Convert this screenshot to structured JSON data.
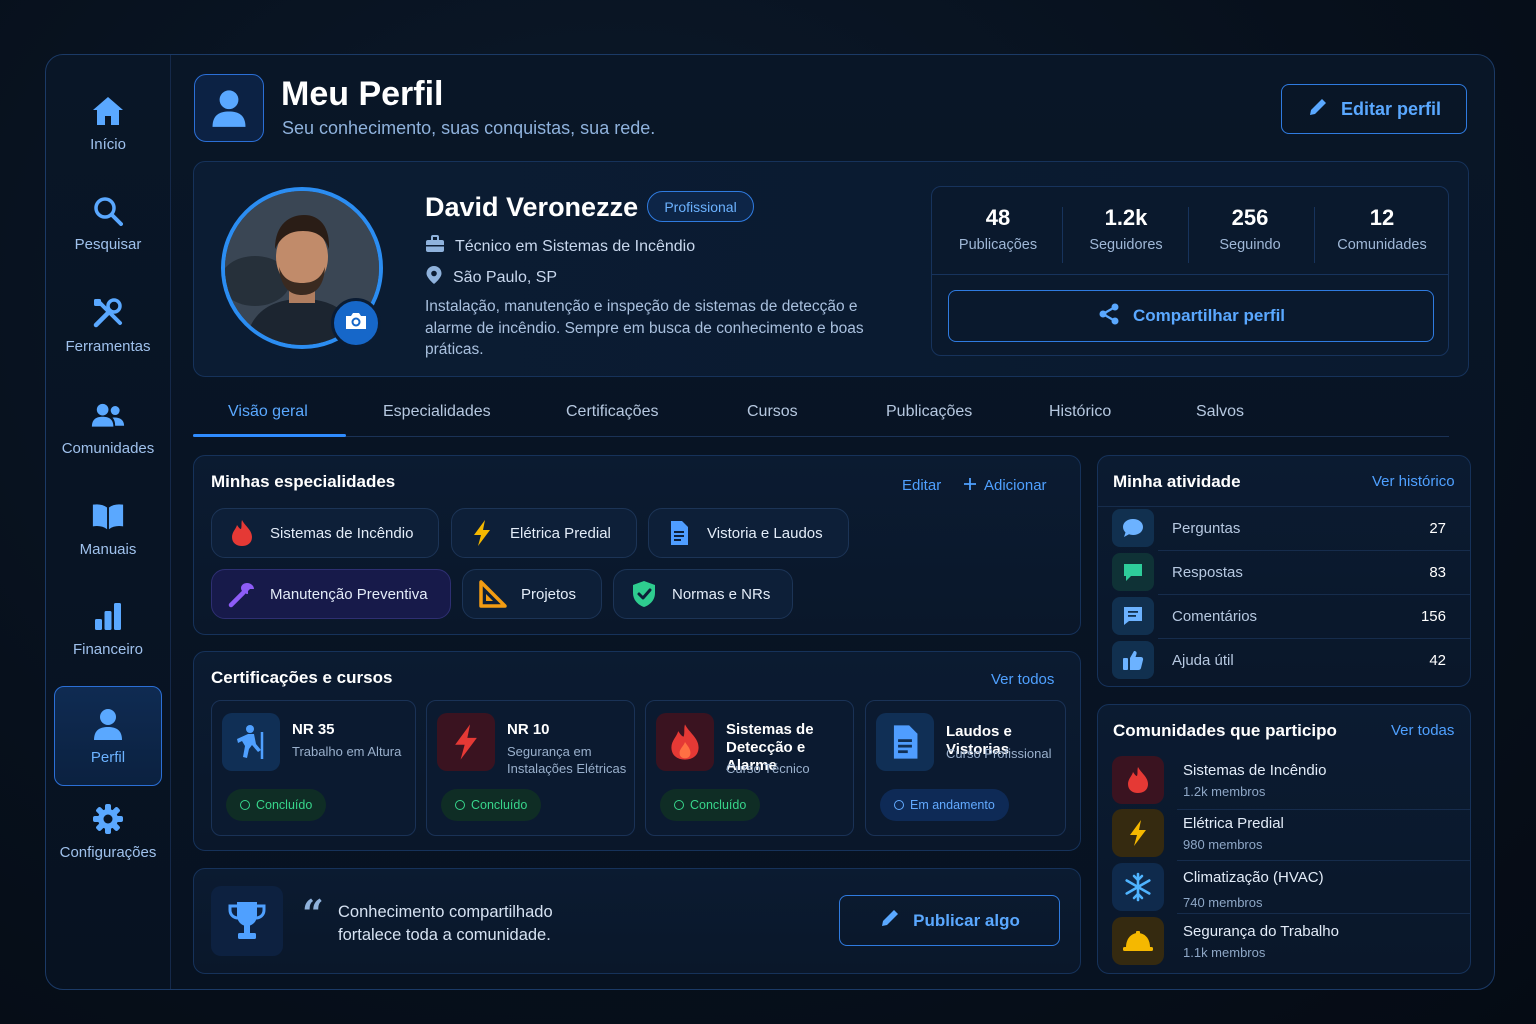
{
  "sidebar": {
    "items": [
      {
        "label": "Início",
        "icon": "home-icon"
      },
      {
        "label": "Pesquisar",
        "icon": "search-icon"
      },
      {
        "label": "Ferramentas",
        "icon": "tools-icon"
      },
      {
        "label": "Comunidades",
        "icon": "people-icon"
      },
      {
        "label": "Manuais",
        "icon": "book-icon"
      },
      {
        "label": "Financeiro",
        "icon": "bar-chart-icon"
      },
      {
        "label": "Perfil",
        "icon": "user-icon",
        "active": true
      },
      {
        "label": "Configurações",
        "icon": "gear-icon"
      }
    ]
  },
  "header": {
    "title": "Meu Perfil",
    "subtitle": "Seu conhecimento, suas conquistas, sua rede.",
    "edit_label": "Editar perfil"
  },
  "profile": {
    "name": "David Veronezze",
    "badge": "Profissional",
    "role": "Técnico em Sistemas de Incêndio",
    "location": "São Paulo, SP",
    "bio": "Instalação, manutenção e inspeção de sistemas de detecção e alarme de incêndio. Sempre em busca de conhecimento e boas práticas.",
    "stats": [
      {
        "value": "48",
        "label": "Publicações"
      },
      {
        "value": "1.2k",
        "label": "Seguidores"
      },
      {
        "value": "256",
        "label": "Seguindo"
      },
      {
        "value": "12",
        "label": "Comunidades"
      }
    ],
    "share_label": "Compartilhar perfil"
  },
  "tabs": [
    "Visão geral",
    "Especialidades",
    "Certificações",
    "Cursos",
    "Publicações",
    "Histórico",
    "Salvos"
  ],
  "specialties": {
    "title": "Minhas especialidades",
    "edit_label": "Editar",
    "add_label": "Adicionar",
    "items": [
      {
        "label": "Sistemas de Incêndio",
        "icon": "flame-icon",
        "color": "#e53935"
      },
      {
        "label": "Elétrica Predial",
        "icon": "bolt-icon",
        "color": "#f5b800"
      },
      {
        "label": "Vistoria e Laudos",
        "icon": "document-icon",
        "color": "#4f9dff"
      },
      {
        "label": "Manutenção Preventiva",
        "icon": "wrench-icon",
        "color": "#8e5cf7"
      },
      {
        "label": "Projetos",
        "icon": "ruler-icon",
        "color": "#f39c12"
      },
      {
        "label": "Normas e NRs",
        "icon": "shield-check-icon",
        "color": "#2ecc8f"
      }
    ]
  },
  "certifications": {
    "title": "Certificações e cursos",
    "see_all": "Ver todos",
    "items": [
      {
        "title": "NR 35",
        "sub": "Trabalho em Altura",
        "status": "Concluído",
        "icon": "climber-icon"
      },
      {
        "title": "NR 10",
        "sub": "Segurança em Instalações Elétricas",
        "status": "Concluído",
        "icon": "bolt-icon"
      },
      {
        "title": "Sistemas de Detecção e Alarme",
        "sub": "Curso Técnico",
        "status": "Concluído",
        "icon": "flame-icon"
      },
      {
        "title": "Laudos e Vistorias",
        "sub": "Curso Profissional",
        "status": "Em andamento",
        "icon": "document-icon"
      }
    ]
  },
  "quote": {
    "mark": "“",
    "text": "Conhecimento compartilhado fortalece toda a comunidade.",
    "publish_label": "Publicar algo"
  },
  "activity": {
    "title": "Minha atividade",
    "link": "Ver histórico",
    "items": [
      {
        "label": "Perguntas",
        "value": "27",
        "icon": "question-bubble-icon"
      },
      {
        "label": "Respostas",
        "value": "83",
        "icon": "answer-bubble-icon"
      },
      {
        "label": "Comentários",
        "value": "156",
        "icon": "comment-icon"
      },
      {
        "label": "Ajuda útil",
        "value": "42",
        "icon": "thumbs-up-icon"
      }
    ]
  },
  "communities": {
    "title": "Comunidades que participo",
    "link": "Ver todas",
    "items": [
      {
        "name": "Sistemas de Incêndio",
        "members": "1.2k membros",
        "icon": "flame-icon"
      },
      {
        "name": "Elétrica Predial",
        "members": "980 membros",
        "icon": "bolt-icon"
      },
      {
        "name": "Climatização (HVAC)",
        "members": "740 membros",
        "icon": "snowflake-icon"
      },
      {
        "name": "Segurança do Trabalho",
        "members": "1.1k membros",
        "icon": "hard-hat-icon"
      }
    ]
  },
  "colors": {
    "accent": "#2f8cff",
    "background": "#07101c",
    "success": "#37d58b"
  }
}
